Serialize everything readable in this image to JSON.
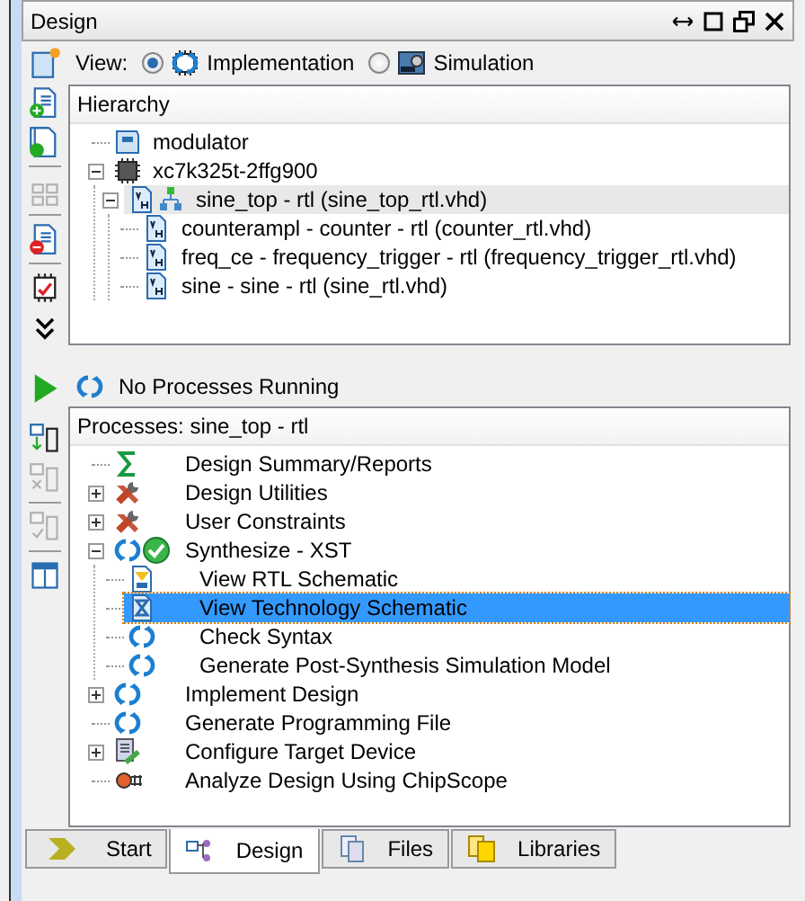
{
  "panel": {
    "title": "Design"
  },
  "view": {
    "label": "View:",
    "options": [
      {
        "label": "Implementation",
        "kind": "implementation",
        "selected": true
      },
      {
        "label": "Simulation",
        "kind": "simulation",
        "selected": false
      }
    ]
  },
  "hierarchy": {
    "header": "Hierarchy",
    "items": [
      {
        "label": "modulator",
        "kind": "project",
        "selected": false
      },
      {
        "label": "xc7k325t-2ffg900",
        "kind": "device",
        "selected": false,
        "expanded": true,
        "children": [
          {
            "label": "sine_top - rtl (sine_top_rtl.vhd)",
            "kind": "top",
            "selected": true,
            "expanded": true,
            "children": [
              {
                "label": "counterampl - counter - rtl (counter_rtl.vhd)",
                "kind": "source",
                "selected": false
              },
              {
                "label": "freq_ce - frequency_trigger - rtl (frequency_trigger_rtl.vhd)",
                "kind": "source",
                "selected": false
              },
              {
                "label": "sine - sine - rtl (sine_rtl.vhd)",
                "kind": "source",
                "selected": false
              }
            ]
          }
        ]
      }
    ]
  },
  "status": {
    "text": "No Processes Running"
  },
  "processes": {
    "header": "Processes: sine_top - rtl",
    "items": [
      {
        "label": "Design Summary/Reports",
        "kind": "summary",
        "selected": false
      },
      {
        "label": "Design Utilities",
        "kind": "tools",
        "selected": false,
        "expanded": false
      },
      {
        "label": "User Constraints",
        "kind": "tools",
        "selected": false,
        "expanded": false
      },
      {
        "label": "Synthesize - XST",
        "kind": "run",
        "done": true,
        "selected": false,
        "expanded": true,
        "children": [
          {
            "label": "View RTL Schematic",
            "kind": "rtl",
            "selected": false
          },
          {
            "label": "View Technology Schematic",
            "kind": "tech",
            "selected": true
          },
          {
            "label": "Check Syntax",
            "kind": "run",
            "selected": false
          },
          {
            "label": "Generate Post-Synthesis Simulation Model",
            "kind": "run",
            "selected": false
          }
        ]
      },
      {
        "label": "Implement Design",
        "kind": "run",
        "selected": false,
        "expanded": false
      },
      {
        "label": "Generate Programming File",
        "kind": "run",
        "selected": false
      },
      {
        "label": "Configure Target Device",
        "kind": "config",
        "selected": false,
        "expanded": false
      },
      {
        "label": "Analyze Design Using ChipScope",
        "kind": "probe",
        "selected": false
      }
    ]
  },
  "tabs": [
    {
      "label": "Start",
      "kind": "start",
      "selected": false
    },
    {
      "label": "Design",
      "kind": "design",
      "selected": true
    },
    {
      "label": "Files",
      "kind": "files",
      "selected": false
    },
    {
      "label": "Libraries",
      "kind": "libraries",
      "selected": false
    }
  ]
}
